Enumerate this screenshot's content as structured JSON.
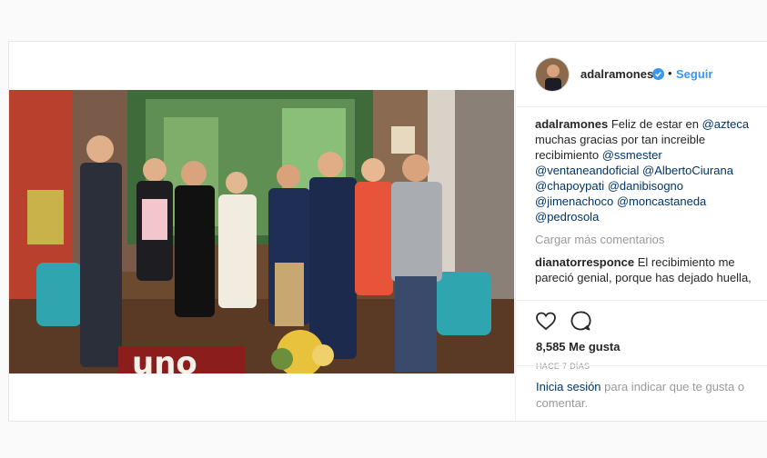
{
  "post": {
    "username": "adalramones",
    "separator": "•",
    "follow_label": "Seguir",
    "caption": {
      "username": "adalramones",
      "text_1": "Feliz de estar en",
      "mention_1": "@azteca",
      "text_2": "muchas gracias por tan increible recibimiento",
      "mentions": [
        "@ssmester",
        "@ventaneandoficial",
        "@AlbertoCiurana",
        "@chapoypati",
        "@danibisogno",
        "@jimenachoco",
        "@moncastaneda",
        "@pedrosola"
      ]
    },
    "load_more_label": "Cargar más comentarios",
    "comment": {
      "username": "dianatorresponce",
      "text": "El recibimiento me pareció genial, porque has dejado huella,"
    },
    "likes": "8,585 Me gusta",
    "date": "HACE 7 DÍAS",
    "login_link": "Inicia sesión",
    "login_text": "para indicar que te gusta o comentar."
  },
  "photo": {
    "sign_text": "uno"
  },
  "icons": {
    "verified": "verified-badge-icon",
    "like": "heart-icon",
    "comment": "comment-bubble-icon"
  },
  "colors": {
    "link_blue": "#3897f0",
    "mention_blue": "#003569",
    "muted": "#999999",
    "text": "#262626"
  }
}
